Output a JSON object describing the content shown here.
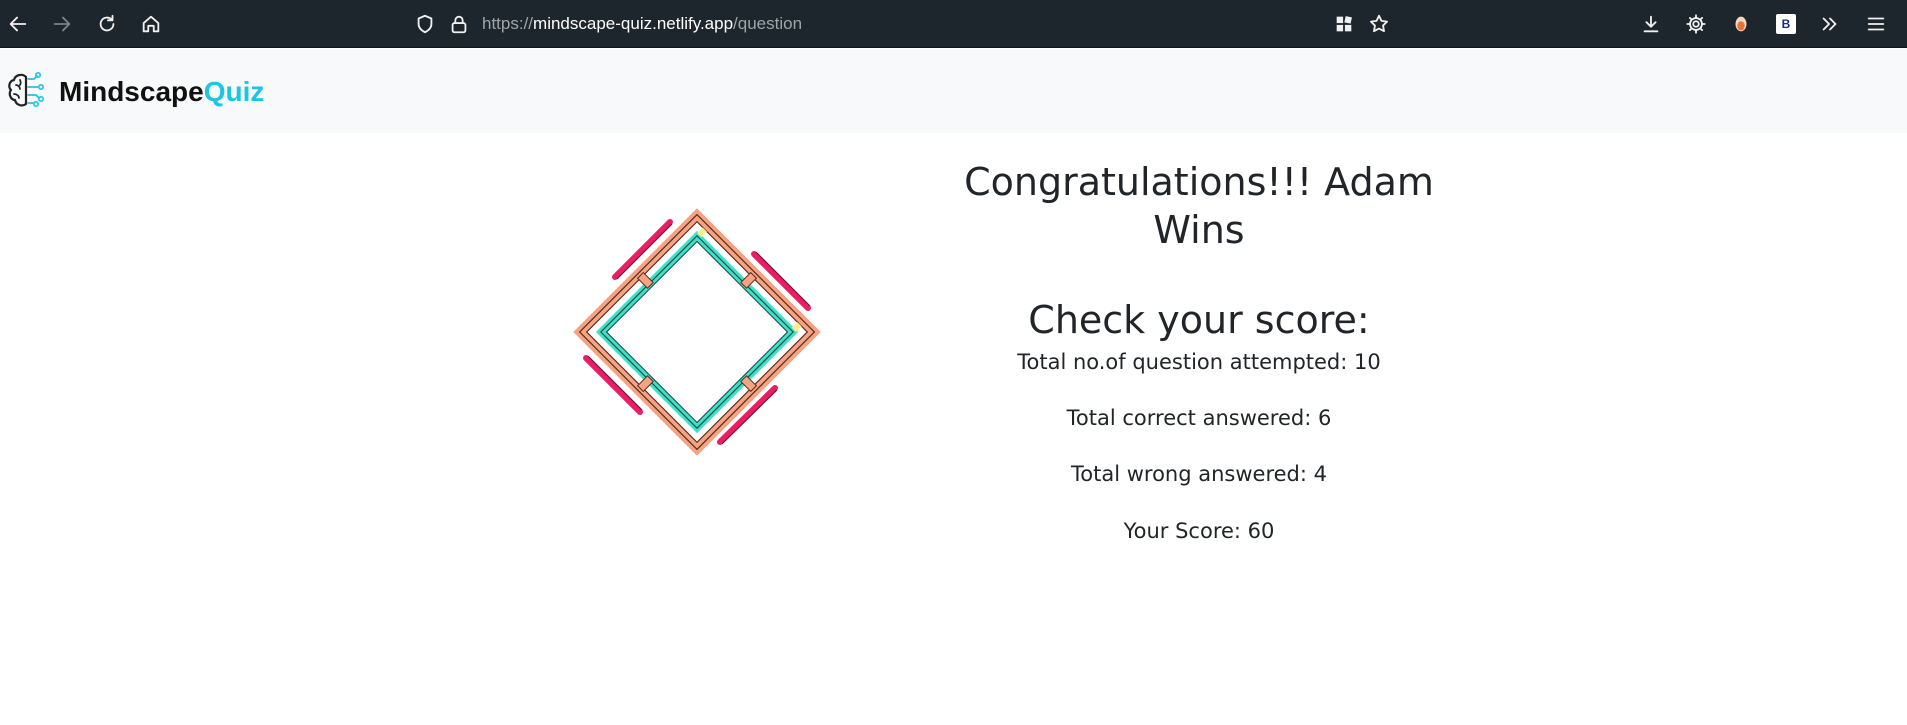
{
  "browser": {
    "url_scheme": "https://",
    "url_host": "mindscape-quiz.netlify.app",
    "url_path": "/question",
    "extension_label": "B"
  },
  "brand": {
    "name_part1": "Mindscape",
    "name_part2": "Quiz",
    "accent_color": "#1ec4e3"
  },
  "result": {
    "congrats": "Congratulations!!! Adam Wins",
    "check_heading": "Check your score:",
    "attempted_label": "Total no.of question attempted: 10",
    "correct_label": "Total correct answered: 6",
    "wrong_label": "Total wrong answered: 4",
    "score_label": "Your Score: 60"
  },
  "colors": {
    "chrome_bg": "#1c262c",
    "header_bg": "#f8f9fa",
    "frame_salmon": "#f4a383",
    "frame_teal": "#40e0c8",
    "frame_pink": "#e91e63"
  },
  "icons": [
    "back-icon",
    "forward-icon",
    "reload-icon",
    "home-icon",
    "shield-icon",
    "lock-icon",
    "grid-icon",
    "star-icon",
    "download-icon",
    "gear-icon",
    "extension-icon",
    "more-tools-icon",
    "menu-icon",
    "brain-logo-icon",
    "trophy-frame-illustration"
  ]
}
